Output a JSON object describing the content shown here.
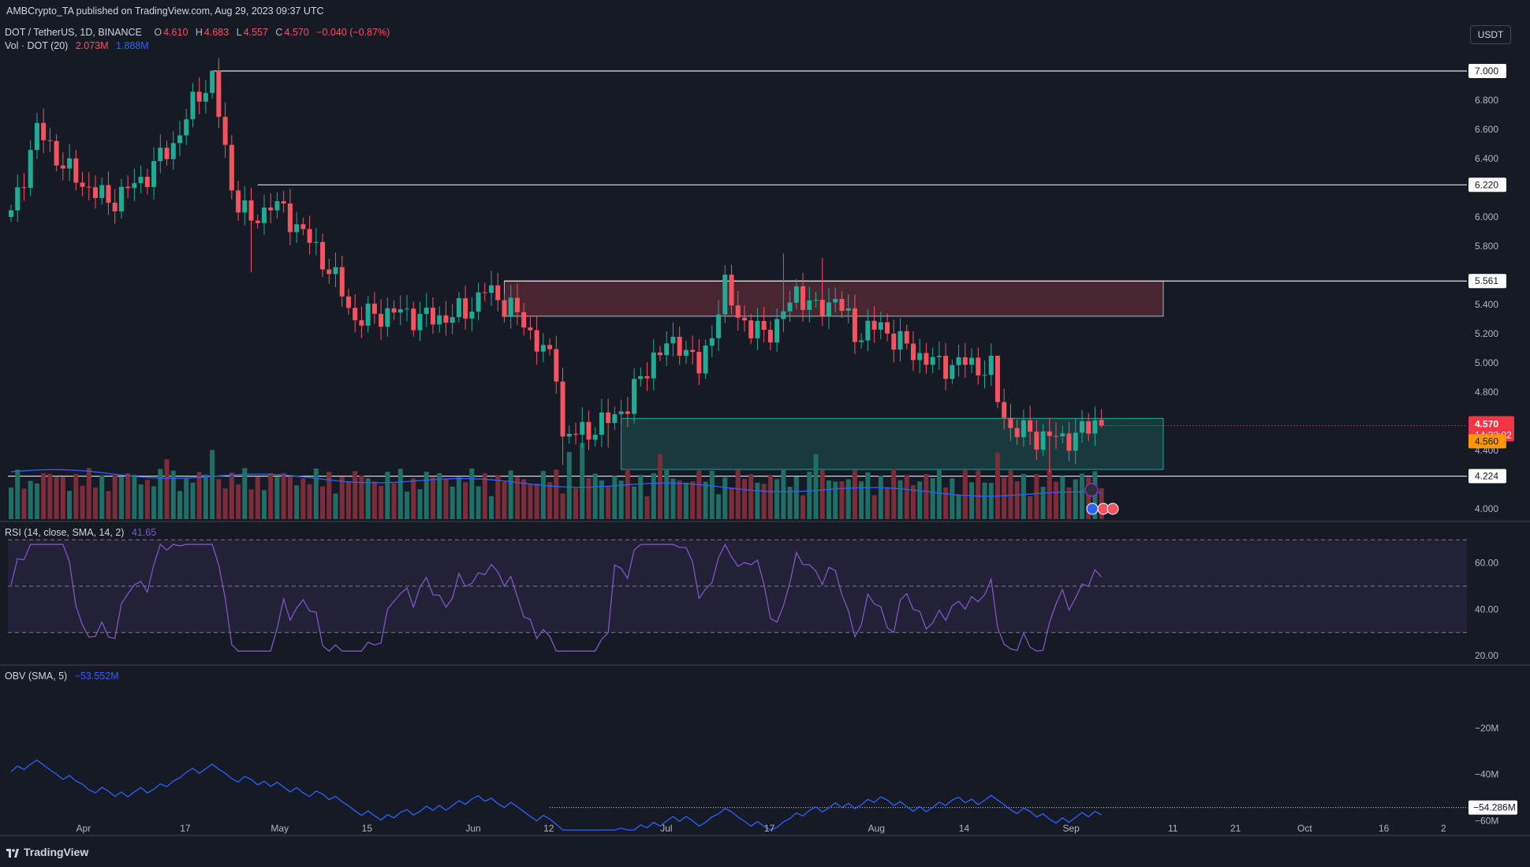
{
  "header": {
    "published": "AMBCrypto_TA published on TradingView.com, Aug 29, 2023 09:37 UTC",
    "symbol": "DOT / TetherUS, 1D, BINANCE",
    "ohlc": {
      "o_label": "O",
      "o": "4.610",
      "h_label": "H",
      "h": "4.683",
      "l_label": "L",
      "l": "4.557",
      "c_label": "C",
      "c": "4.570",
      "change": "−0.040 (−0.87%)"
    },
    "vol_label": "Vol · DOT (20)",
    "vol_value": "2.073M",
    "vol_ma": "1.888M",
    "currency_button": "USDT"
  },
  "chart_data": [
    {
      "type": "candlestick",
      "title": "DOT / TetherUS, 1D, BINANCE",
      "y_ticks": [
        "4.000",
        "4.200",
        "4.400",
        "4.600",
        "4.800",
        "5.000",
        "5.200",
        "5.400",
        "5.600",
        "5.800",
        "6.000",
        "6.200",
        "6.400",
        "6.600",
        "6.800",
        "7.000"
      ],
      "x_ticks": [
        "Apr",
        "17",
        "May",
        "15",
        "Jun",
        "12",
        "Jul",
        "17",
        "Aug",
        "14",
        "Sep",
        "11",
        "21",
        "Oct",
        "16",
        "2"
      ],
      "levels": [
        {
          "value": 7.0,
          "label": "7.000"
        },
        {
          "value": 6.22,
          "label": "6.220"
        },
        {
          "value": 5.561,
          "label": "5.561"
        },
        {
          "value": 4.224,
          "label": "4.224"
        }
      ],
      "zones": [
        {
          "kind": "supply",
          "top": 5.561,
          "bottom": 5.32,
          "color": "#f7525f"
        },
        {
          "kind": "demand",
          "top": 4.62,
          "bottom": 4.27,
          "color": "#22ab94"
        }
      ],
      "last_price": {
        "value": 4.57,
        "label": "4.570",
        "countdown": "14:22:02"
      },
      "secondary_price": {
        "value": 4.56,
        "label": "4.560"
      },
      "colors": {
        "up": "#22ab94",
        "down": "#f7525f",
        "vol_up": "#1f6f66",
        "vol_down": "#7d2d3a",
        "vol_ma": "#2962ff"
      },
      "vol_ma_label": "1.888M"
    },
    {
      "type": "line",
      "title": "RSI (14, close, SMA, 14, 2)",
      "value_label": "41.65",
      "y_ticks": [
        "20.00",
        "40.00",
        "60.00"
      ],
      "bands": [
        70,
        50,
        30
      ],
      "color": "#7e57c2"
    },
    {
      "type": "line",
      "title": "OBV (SMA, 5)",
      "value_label": "−53.552M",
      "y_ticks": [
        "−20M",
        "−40M",
        "−60M"
      ],
      "last_label": "−54.286M",
      "color": "#2962ff"
    }
  ],
  "footer": {
    "brand": "TradingView"
  }
}
